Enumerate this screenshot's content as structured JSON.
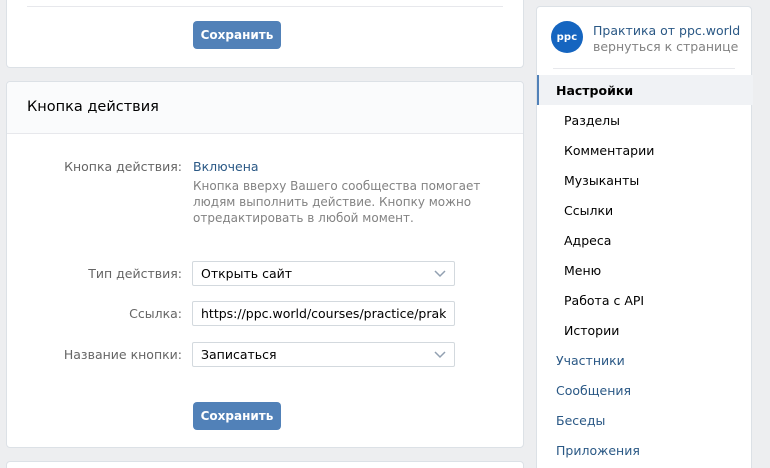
{
  "top_section": {
    "save_label": "Сохранить"
  },
  "action_section": {
    "title": "Кнопка действия",
    "status_label": "Кнопка действия:",
    "status_value": "Включена",
    "hint": "Кнопка вверху Вашего сообщества помогает людям выполнить действие. Кнопку можно отредактировать в любой момент.",
    "type_label": "Тип действия:",
    "type_value": "Открыть сайт",
    "link_label": "Ссылка:",
    "link_value": "https://ppc.world/courses/practice/praktika-ppc",
    "name_label": "Название кнопки:",
    "name_value": "Записаться",
    "save_label": "Сохранить"
  },
  "sidebar": {
    "community": {
      "avatar_text": "ppc",
      "name": "Практика от ppc.world",
      "back_link": "вернуться к странице"
    },
    "items": [
      {
        "label": "Настройки",
        "level": "main",
        "active": true
      },
      {
        "label": "Разделы",
        "level": "sub"
      },
      {
        "label": "Комментарии",
        "level": "sub"
      },
      {
        "label": "Музыканты",
        "level": "sub"
      },
      {
        "label": "Ссылки",
        "level": "sub"
      },
      {
        "label": "Адреса",
        "level": "sub"
      },
      {
        "label": "Меню",
        "level": "sub"
      },
      {
        "label": "Работа с API",
        "level": "sub"
      },
      {
        "label": "Истории",
        "level": "sub"
      },
      {
        "label": "Участники",
        "level": "main"
      },
      {
        "label": "Сообщения",
        "level": "main"
      },
      {
        "label": "Беседы",
        "level": "main"
      },
      {
        "label": "Приложения",
        "level": "main"
      }
    ]
  },
  "colors": {
    "accent": "#5181b8",
    "link": "#2a5885",
    "background": "#edeef0",
    "avatar": "#1565c0"
  },
  "icons": {
    "dropdown": "chevron-down-icon"
  }
}
